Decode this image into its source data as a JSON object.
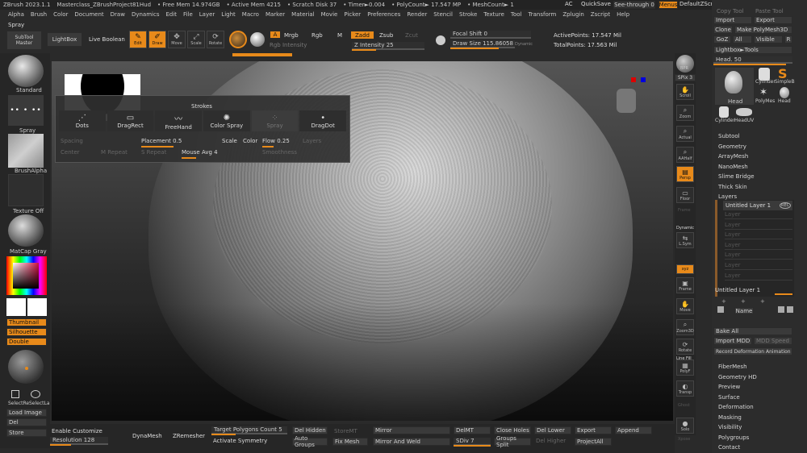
{
  "titlebar": {
    "app": "ZBrush 2023.1.1",
    "project": "Masterclass_ZBrushProject81Hud",
    "free_mem": "• Free Mem 14.974GB",
    "active_mem": "• Active Mem 4215",
    "scratch": "• Scratch Disk 37",
    "timer": "• Timer►0.004",
    "polycount": "• PolyCount► 17.547 MP",
    "meshcount": "• MeshCount► 1",
    "ac": "AC",
    "quicksave": "QuickSave",
    "seethrough": "See-through 0",
    "menus": "Menus",
    "default_script": "DefaultZScript"
  },
  "menubar": [
    "Alpha",
    "Brush",
    "Color",
    "Document",
    "Draw",
    "Dynamics",
    "Edit",
    "File",
    "Layer",
    "Light",
    "Macro",
    "Marker",
    "Material",
    "Movie",
    "Picker",
    "Preferences",
    "Render",
    "Stencil",
    "Stroke",
    "Texture",
    "Tool",
    "Transform",
    "Zplugin",
    "Zscript",
    "Help"
  ],
  "spray_label": "Spray",
  "toolbar": {
    "subtool_master": "SubTool Master",
    "lightbox": "LightBox",
    "live_boolean": "Live Boolean",
    "edit": "Edit",
    "draw": "Draw",
    "move": "Move",
    "scale": "Scale",
    "rotate": "Rotate",
    "a": "A",
    "mrgb": "Mrgb",
    "rgb": "Rgb",
    "m": "M",
    "rgb_intensity": "Rgb Intensity",
    "zadd": "Zadd",
    "zsub": "Zsub",
    "zcut": "Zcut",
    "z_intensity": "Z Intensity 25",
    "focal_shift": "Focal Shift 0",
    "draw_size": "Draw Size 115.86058",
    "dynamic": "Dynamic",
    "active_points": "ActivePoints: 17.547 Mil",
    "total_points": "TotalPoints: 17.563 Mil"
  },
  "left": {
    "standard": "Standard",
    "spray": "Spray",
    "brush_alpha": "BrushAlpha",
    "texture_off": "Texture Off",
    "matcap": "MatCap Gray",
    "thumbnail": "Thumbnail",
    "silhouette": "Silhouette",
    "double": "Double",
    "select_rect": "SelectRe",
    "select_lasso": "SelectLa",
    "load_image": "Load Image",
    "del": "Del",
    "store": "Store"
  },
  "strokes": {
    "title": "Strokes",
    "items": [
      "Dots",
      "DragRect",
      "FreeHand",
      "Color Spray",
      "Spray",
      "DragDot"
    ],
    "spacing": "Spacing",
    "placement": "Placement 0.5",
    "scale": "Scale",
    "color": "Color",
    "flow": "Flow 0.25",
    "layers": "Layers",
    "center": "Center",
    "m_repeat": "M Repeat",
    "s_repeat": "S Repeat",
    "mouse_avg": "Mouse Avg 4",
    "smoothness": "Smoothness"
  },
  "nav": {
    "bpr": "BPR",
    "spix": "SPix 3",
    "scroll": "Scroll",
    "zoom": "Zoom",
    "actual": "Actual",
    "aahalf": "AAHalf",
    "persp": "Persp",
    "floor": "Floor",
    "frame_l": "Frame",
    "dynamic": "Dynamic",
    "lsym": "L.Sym",
    "xyz": "xyz",
    "frame": "Frame",
    "move": "Move",
    "zoom3d": "Zoom3D",
    "rotate": "Rotate",
    "line_fill": "Line Fill",
    "polyf": "PolyF",
    "transp": "Transp",
    "ghost": "Ghost",
    "solo": "Solo",
    "xpose": "Xpose"
  },
  "rightpanel": {
    "copy_tool": "Copy Tool",
    "paste_tool": "Paste Tool",
    "import": "Import",
    "export": "Export",
    "clone": "Clone",
    "make_polymesh": "Make PolyMesh3D",
    "goz": "GoZ",
    "all": "All",
    "visible": "Visible",
    "r": "R",
    "lightbox_tools": "Lightbox►Tools",
    "head": "Head. 50",
    "thumbs": [
      "Head",
      "Cylinder",
      "SimpleB",
      "PolyMes",
      "Head",
      "Cylinder",
      "HeadUV"
    ],
    "sections": [
      "Subtool",
      "Geometry",
      "ArrayMesh",
      "NanoMesh",
      "Slime Bridge",
      "Thick Skin",
      "Layers"
    ],
    "layer_name": "Untitled Layer 1",
    "rec": "REC",
    "layer_slots": [
      "Layer",
      "Layer",
      "Layer",
      "Layer",
      "Layer",
      "Layer",
      "Layer"
    ],
    "layer_name2": "Untitled Layer 1",
    "name": "Name",
    "bake_all": "Bake All",
    "import_mdd": "Import MDD",
    "mdd_speed": "MDD Speed",
    "record_deform": "Record Deformation Animation",
    "sections2": [
      "FiberMesh",
      "Geometry HD",
      "Preview",
      "Surface",
      "Deformation",
      "Masking",
      "Visibility",
      "Polygroups",
      "Contact"
    ]
  },
  "bottom": {
    "enable_customize": "Enable Customize",
    "resolution": "Resolution 128",
    "dynamesh": "DynaMesh",
    "zremesher": "ZRemesher",
    "target_polys": "Target Polygons Count 5",
    "activate_symmetry": "Activate Symmetry",
    "del_hidden": "Del Hidden",
    "auto_groups": "Auto Groups",
    "store_mt": "StoreMT",
    "fix_mesh": "Fix Mesh",
    "mirror": "Mirror",
    "mirror_weld": "Mirror And Weld",
    "del_mt": "DelMT",
    "sdiv": "SDiv 7",
    "close_holes": "Close Holes",
    "groups_split": "Groups Split",
    "del_lower": "Del Lower",
    "del_higher": "Del Higher",
    "export": "Export",
    "project_all": "ProjectAll",
    "append": "Append"
  }
}
